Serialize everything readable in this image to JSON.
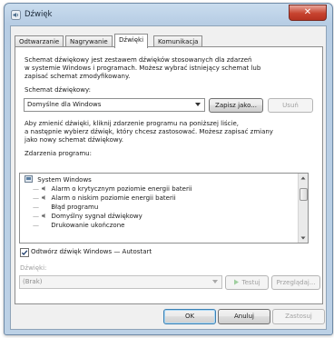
{
  "window": {
    "title": "Dźwięk",
    "close_label": "✕"
  },
  "tabs": [
    {
      "label": "Odtwarzanie"
    },
    {
      "label": "Nagrywanie"
    },
    {
      "label": "Dźwięki"
    },
    {
      "label": "Komunikacja"
    }
  ],
  "active_tab": "Dźwięki",
  "intro": {
    "line1": "Schemat dźwiękowy jest zestawem dźwięków stosowanych dla zdarzeń",
    "line2": "w systemie Windows i programach. Możesz wybrać istniejący schemat lub",
    "line3": "zapisać schemat zmodyfikowany."
  },
  "scheme": {
    "label": "Schemat dźwiękowy:",
    "value": "Domyślne dla Windows",
    "save_button": "Zapisz jako...",
    "delete_button": "Usuń"
  },
  "instructions": {
    "line1": "Aby zmienić dźwięki, kliknij zdarzenie programu na poniższej liście,",
    "line2": "a następnie wybierz dźwięk, który chcesz zastosować. Możesz zapisać zmiany",
    "line3": "jako nowy schemat dźwiękowy."
  },
  "events": {
    "label": "Zdarzenia programu:",
    "items": [
      {
        "text": "System Windows"
      },
      {
        "text": "Alarm o krytycznym poziomie energii baterii"
      },
      {
        "text": "Alarm o niskim poziomie energii baterii"
      },
      {
        "text": "Błąd programu"
      },
      {
        "text": "Domyślny sygnał dźwiękowy"
      },
      {
        "text": "Drukowanie ukończone"
      }
    ]
  },
  "startup": {
    "label": "Odtwórz dźwięk Windows — Autostart",
    "checked": true
  },
  "sounds": {
    "label": "Dźwięki:",
    "value": "(Brak)",
    "test_button": "Testuj",
    "browse_button": "Przeglądaj..."
  },
  "footer": {
    "ok": "OK",
    "cancel": "Anuluj",
    "apply": "Zastosuj"
  },
  "colors": {
    "accent_green": "#3aa23a",
    "titlebar": "#b7cde4",
    "close_red": "#c7432f"
  }
}
